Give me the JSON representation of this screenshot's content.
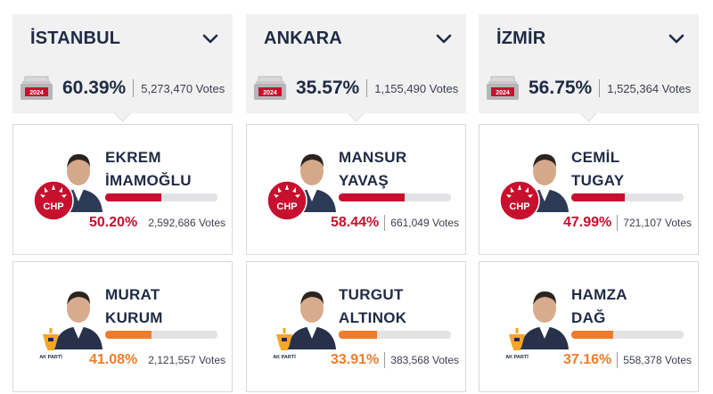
{
  "colors": {
    "chp": "#c8102e",
    "akp": "#f07c2b",
    "navy": "#1f2a44"
  },
  "cities": [
    {
      "name": "İSTANBUL",
      "year": "2024",
      "turnout_pct": "60.39%",
      "turnout_votes": "5,273,470 Votes",
      "candidates": [
        {
          "first": "EKREM",
          "last": "İMAMOĞLU",
          "party": "CHP",
          "party_logo_text": "CHP",
          "pct": "50.20%",
          "share": 0.502,
          "votes": "2,592,686 Votes"
        },
        {
          "first": "MURAT",
          "last": "KURUM",
          "party": "AK PARTİ",
          "party_logo_text": "AK PARTİ",
          "pct": "41.08%",
          "share": 0.4108,
          "votes": "2,121,557 Votes"
        }
      ]
    },
    {
      "name": "ANKARA",
      "year": "2024",
      "turnout_pct": "35.57%",
      "turnout_votes": "1,155,490 Votes",
      "candidates": [
        {
          "first": "MANSUR",
          "last": "YAVAŞ",
          "party": "CHP",
          "party_logo_text": "CHP",
          "pct": "58.44%",
          "share": 0.5844,
          "votes": "661,049 Votes"
        },
        {
          "first": "TURGUT",
          "last": "ALTINOK",
          "party": "AK PARTİ",
          "party_logo_text": "AK PARTİ",
          "pct": "33.91%",
          "share": 0.3391,
          "votes": "383,568 Votes"
        }
      ]
    },
    {
      "name": "İZMİR",
      "year": "2024",
      "turnout_pct": "56.75%",
      "turnout_votes": "1,525,364 Votes",
      "candidates": [
        {
          "first": "CEMİL",
          "last": "TUGAY",
          "party": "CHP",
          "party_logo_text": "CHP",
          "pct": "47.99%",
          "share": 0.4799,
          "votes": "721,107 Votes"
        },
        {
          "first": "HAMZA",
          "last": "DAĞ",
          "party": "AK PARTİ",
          "party_logo_text": "AK PARTİ",
          "pct": "37.16%",
          "share": 0.3716,
          "votes": "558,378 Votes"
        }
      ]
    }
  ]
}
